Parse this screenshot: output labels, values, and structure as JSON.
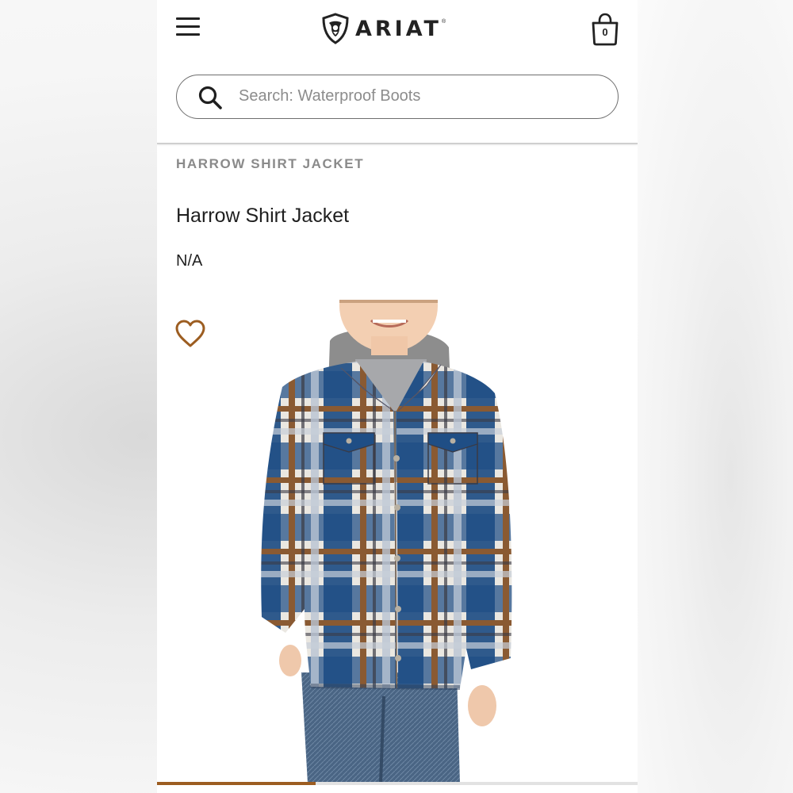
{
  "header": {
    "menu_icon": "hamburger-menu-icon",
    "brand": "ARIAT",
    "brand_mark": "®",
    "cart": {
      "icon": "shopping-bag-icon",
      "count": "0"
    }
  },
  "search": {
    "icon": "search-icon",
    "placeholder": "Search:  Waterproof Boots"
  },
  "product": {
    "eyebrow": "HARROW SHIRT JACKET",
    "title": "Harrow Shirt Jacket",
    "price": "N/A",
    "wishlist_icon": "heart-outline-icon",
    "image_alt": "Boy wearing blue, brown and white plaid hooded shirt jacket with jeans"
  },
  "carousel": {
    "progress": 0.33
  },
  "colors": {
    "accent": "#9c5d21",
    "text": "#1f1f1f",
    "muted": "#8a8a8a",
    "plaid_blue": "#1f4e85",
    "plaid_brown": "#8a5a32"
  }
}
